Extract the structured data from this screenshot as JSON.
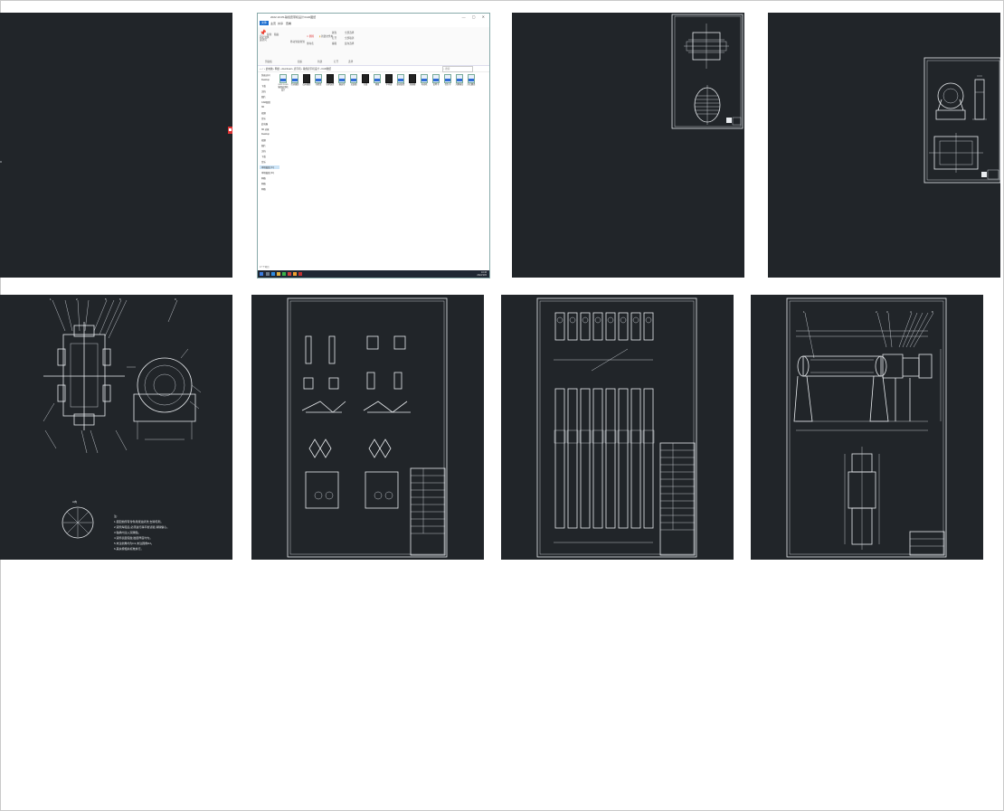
{
  "explorer": {
    "title": "2022.10.05-输煤皮带机设计/CAD图纸",
    "window_controls": "— ▢ ✕",
    "tabs": [
      "文件",
      "主页",
      "共享",
      "查看"
    ],
    "ribbon_groups": [
      "剪贴板",
      "组织",
      "新建",
      "打开",
      "选择"
    ],
    "ribbon_buttons": [
      "固定到快速访问",
      "复制",
      "粘贴",
      "移动到",
      "复制到",
      "删除",
      "重命名",
      "新建文件夹",
      "属性",
      "打开",
      "编辑",
      "全部选择",
      "全部取消",
      "反向选择"
    ],
    "address_path": "‹  ›  ↑  › 此电脑 › 网络 › download › 皮带机 › 输煤皮带机设计 › CAD图纸",
    "search_placeholder": "搜索",
    "nav_items": [
      "快速访问",
      "Desktop",
      "下载",
      "文档",
      "图片",
      "CAD图纸",
      "3D",
      "视频",
      "音乐",
      "此电脑",
      "3D 对象",
      "Desktop",
      "视频",
      "图片",
      "文档",
      "下载",
      "音乐",
      "本地磁盘 (C:)",
      "本地磁盘 (D:)",
      "网络",
      "网络",
      "网络"
    ],
    "nav_selected_index": 17,
    "files": [
      {
        "name": "2022.10.05 输煤皮带机设计",
        "type": "doc"
      },
      {
        "name": "传动滚筒",
        "type": "dwg"
      },
      {
        "name": "改向滚筒",
        "type": "dark"
      },
      {
        "name": "托辊组",
        "type": "dwg"
      },
      {
        "name": "张紧装置",
        "type": "dark"
      },
      {
        "name": "输送带",
        "type": "dwg"
      },
      {
        "name": "总装图",
        "type": "dwg"
      },
      {
        "name": "头架",
        "type": "dark"
      },
      {
        "name": "尾架",
        "type": "dwg"
      },
      {
        "name": "中间架",
        "type": "dark"
      },
      {
        "name": "驱动装置",
        "type": "dwg"
      },
      {
        "name": "减速器",
        "type": "dark"
      },
      {
        "name": "电动机",
        "type": "dwg"
      },
      {
        "name": "说明书",
        "type": "doc"
      },
      {
        "name": "任务书",
        "type": "doc"
      },
      {
        "name": "开题报告",
        "type": "doc"
      },
      {
        "name": "外文翻译",
        "type": "doc"
      }
    ],
    "status": "17 个项目",
    "clock_time": "10:33",
    "clock_date": "2022/10/5"
  },
  "colors": {
    "cad_background": "#212529",
    "cad_line": "#e9ecef",
    "explorer_accent": "#1e6fd0",
    "taskbar": "#1f2733"
  },
  "thumbnails": [
    {
      "id": "blank-drawing"
    },
    {
      "id": "file-explorer-screenshot"
    },
    {
      "id": "drum-drawing"
    },
    {
      "id": "bearing-seat-drawing"
    },
    {
      "id": "drum-assembly-drawing"
    },
    {
      "id": "idler-schematic"
    },
    {
      "id": "idler-layout"
    },
    {
      "id": "conveyor-general-assembly"
    }
  ]
}
